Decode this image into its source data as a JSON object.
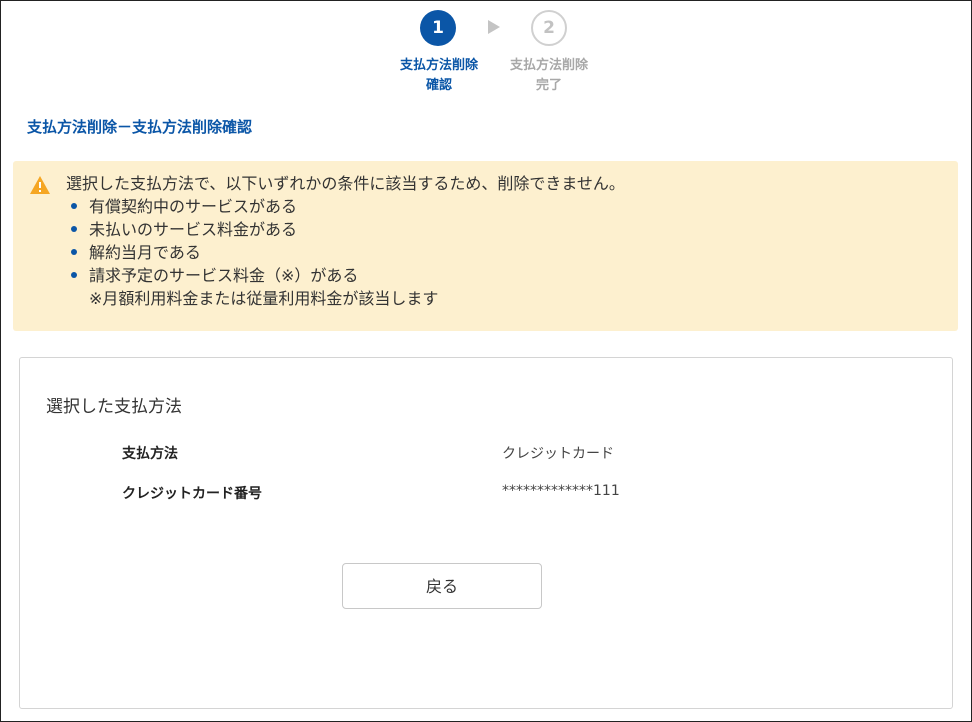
{
  "stepper": {
    "steps": [
      {
        "number": "1",
        "label_line1": "支払方法削除",
        "label_line2": "確認",
        "state": "active"
      },
      {
        "number": "2",
        "label_line1": "支払方法削除",
        "label_line2": "完了",
        "state": "inactive"
      }
    ]
  },
  "page_title": "支払方法削除－支払方法削除確認",
  "warning": {
    "icon": "warning-triangle-icon",
    "message": "選択した支払方法で、以下いずれかの条件に該当するため、削除できません。",
    "conditions": [
      "有償契約中のサービスがある",
      "未払いのサービス料金がある",
      "解約当月である",
      "請求予定のサービス料金（※）がある"
    ],
    "note": "※月額利用料金または従量利用料金が該当します"
  },
  "card": {
    "heading": "選択した支払方法",
    "rows": [
      {
        "label": "支払方法",
        "value": "クレジットカード"
      },
      {
        "label": "クレジットカード番号",
        "value": "*************111"
      }
    ],
    "back_button_label": "戻る"
  },
  "colors": {
    "primary": "#0b56a7",
    "warning_bg": "#fdf0cf",
    "warning_icon": "#f5a623"
  }
}
